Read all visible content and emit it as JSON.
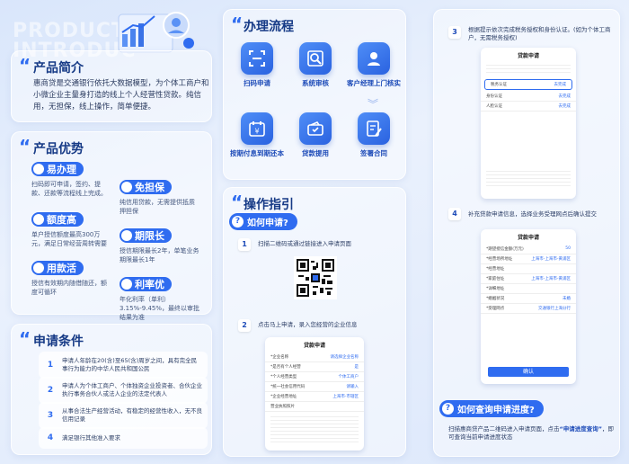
{
  "bg_words": [
    "PRODUCT",
    "INTRODUC"
  ],
  "intro": {
    "title": "产品简介",
    "text": "惠商贷是交通银行依托大数据模型，为个体工商户和小微企业主量身打造的线上个人经营性贷款。纯信用，无担保，线上操作，简单便捷。"
  },
  "advantages": {
    "title": "产品优势",
    "items": [
      {
        "label": "易办理",
        "desc": "扫码即可申请，签约、提款、还款等流程线上完成。",
        "icon": "check-icon"
      },
      {
        "label": "免担保",
        "desc": "纯信用贷款，无需提供抵质押担保",
        "icon": "shield-icon"
      },
      {
        "label": "额度高",
        "desc": "单户授信额度最高300万元，满足日常经营周转需要",
        "icon": "yen-icon"
      },
      {
        "label": "期限长",
        "desc": "授信期限最长2年，单笔业务期限最长1年",
        "icon": "clock-icon"
      },
      {
        "label": "用款活",
        "desc": "授信有效期内随借随还，额度可循环",
        "icon": "cycle-icon"
      },
      {
        "label": "利率优",
        "desc": "年化利率（单利）3.15%-9.45%，最终以审批结果为准",
        "icon": "percent-icon"
      }
    ]
  },
  "conditions": {
    "title": "申请条件",
    "items": [
      {
        "num": "1",
        "text": "申请人年龄在20(含)至65(含)周岁之间，具有完全民事行为能力的中华人民共和国公民"
      },
      {
        "num": "2",
        "text": "申请人为个体工商户、个体独资企业投资者、合伙企业执行事务合伙人或法人企业的法定代表人"
      },
      {
        "num": "3",
        "text": "从事合法生产经营活动，有稳定的经营性收入，无不良信用记录"
      },
      {
        "num": "4",
        "text": "满足银行其他准入要求"
      }
    ]
  },
  "process": {
    "title": "办理流程",
    "steps": [
      {
        "label": "扫码申请",
        "icon": "scan-icon"
      },
      {
        "label": "系统审核",
        "icon": "search-icon"
      },
      {
        "label": "客户经理上门核实",
        "icon": "user-icon"
      },
      {
        "label": "按期付息到期还本",
        "icon": "calendar-yen-icon"
      },
      {
        "label": "贷款提用",
        "icon": "wallet-icon"
      },
      {
        "label": "签署合同",
        "icon": "pen-icon"
      }
    ]
  },
  "guide": {
    "title": "操作指引",
    "how_to_apply": "如何申请?",
    "step1": {
      "num": "1",
      "text": "扫描二维码或通过链接进入申请页面"
    },
    "step2": {
      "num": "2",
      "text": "点击马上申请，录入您经营的企业信息"
    },
    "form_title": "贷款申请",
    "form_rows": [
      {
        "k": "*企业名称",
        "v": "请选择企业名称"
      },
      {
        "k": "*是否有个人经营",
        "v": "是"
      },
      {
        "k": "*个人经营类型",
        "v": "个体工商户"
      },
      {
        "k": "*统一社会信用代码",
        "v": "请输入"
      },
      {
        "k": "*企业经营地址",
        "v": "上海市-市辖区"
      },
      {
        "k": "营业执照照片",
        "v": ""
      }
    ]
  },
  "right": {
    "step3": {
      "num": "3",
      "text": "根据提示依次完成税务授权和身份认证。(如为个体工商户，无需税务授权)"
    },
    "step3_phone": {
      "title": "贷款申请",
      "rows": [
        {
          "k": "税务认证",
          "v": "去完成"
        },
        {
          "k": "身份认证",
          "v": "去完成"
        },
        {
          "k": "人脸认证",
          "v": "去完成"
        }
      ]
    },
    "step4": {
      "num": "4",
      "text": "补充贷款申请信息，选择业务受理网点后确认提交"
    },
    "step4_phone": {
      "title": "贷款申请",
      "rows": [
        {
          "k": "*期望授信金额(万元)",
          "v": "50"
        },
        {
          "k": "*经营场所地址",
          "v": "上海市-上海市-黄浦区"
        },
        {
          "k": "*经营地址",
          "v": ""
        },
        {
          "k": "*家庭住址",
          "v": "上海市-上海市-黄浦区"
        },
        {
          "k": "*详细地址",
          "v": ""
        },
        {
          "k": "*婚姻状况",
          "v": "未婚"
        },
        {
          "k": "*受理网点",
          "v": "交通银行上海分行"
        }
      ],
      "button": "确认"
    },
    "query_title": "如何查询申请进度?",
    "query_text_1": "扫描惠商贷产品二维码进入申请页面，点击",
    "query_text_highlight": "“申请进度查询”",
    "query_text_2": "，即可查询当前申请进度状态"
  }
}
